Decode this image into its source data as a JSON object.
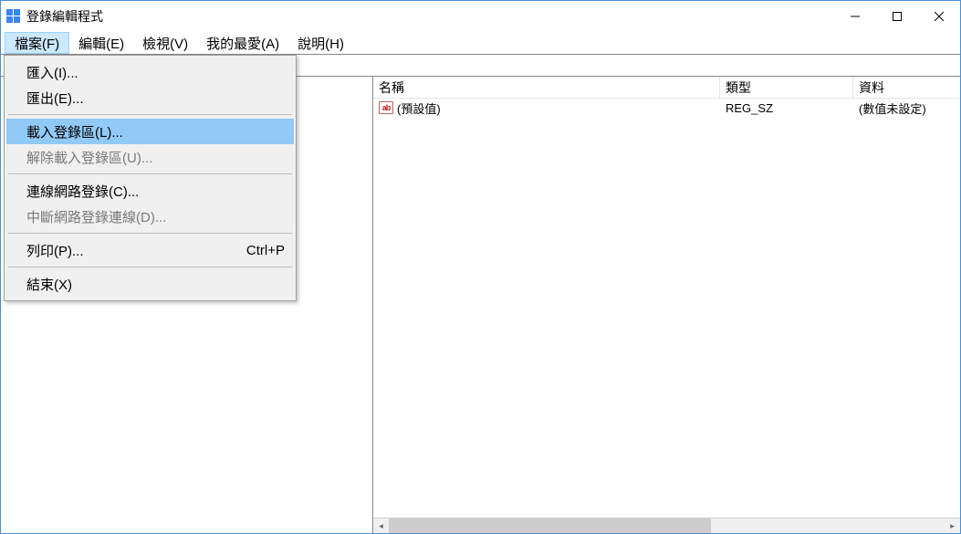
{
  "window": {
    "title": "登錄編輯程式"
  },
  "menubar": {
    "items": [
      {
        "label": "檔案(F)",
        "active": true
      },
      {
        "label": "編輯(E)",
        "active": false
      },
      {
        "label": "檢視(V)",
        "active": false
      },
      {
        "label": "我的最愛(A)",
        "active": false
      },
      {
        "label": "說明(H)",
        "active": false
      }
    ]
  },
  "dropdown": {
    "items": [
      {
        "label": "匯入(I)...",
        "type": "item",
        "enabled": true,
        "highlight": false,
        "shortcut": ""
      },
      {
        "label": "匯出(E)...",
        "type": "item",
        "enabled": true,
        "highlight": false,
        "shortcut": ""
      },
      {
        "type": "sep"
      },
      {
        "label": "載入登錄區(L)...",
        "type": "item",
        "enabled": true,
        "highlight": true,
        "shortcut": ""
      },
      {
        "label": "解除載入登錄區(U)...",
        "type": "item",
        "enabled": false,
        "highlight": false,
        "shortcut": ""
      },
      {
        "type": "sep"
      },
      {
        "label": "連線網路登錄(C)...",
        "type": "item",
        "enabled": true,
        "highlight": false,
        "shortcut": ""
      },
      {
        "label": "中斷網路登錄連線(D)...",
        "type": "item",
        "enabled": false,
        "highlight": false,
        "shortcut": ""
      },
      {
        "type": "sep"
      },
      {
        "label": "列印(P)...",
        "type": "item",
        "enabled": true,
        "highlight": false,
        "shortcut": "Ctrl+P"
      },
      {
        "type": "sep"
      },
      {
        "label": "結束(X)",
        "type": "item",
        "enabled": true,
        "highlight": false,
        "shortcut": ""
      }
    ]
  },
  "list": {
    "columns": {
      "name": "名稱",
      "type": "類型",
      "data": "資料"
    },
    "rows": [
      {
        "icon": "string",
        "name": "(預設值)",
        "type": "REG_SZ",
        "data": "(數值未設定)"
      }
    ]
  }
}
